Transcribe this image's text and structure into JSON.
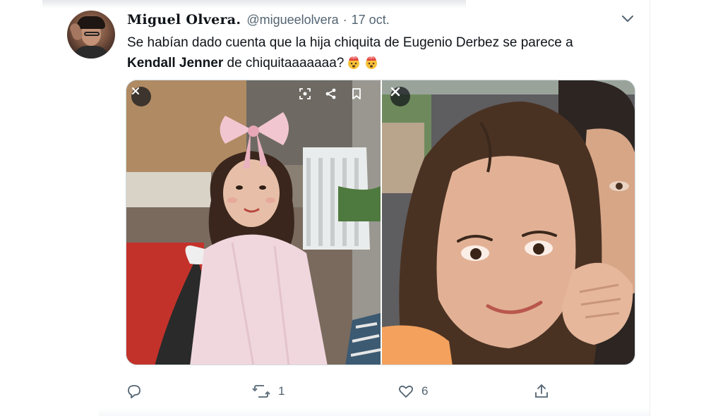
{
  "tweet": {
    "author_name": "Miguel Olvera.",
    "handle": "@migueelolvera",
    "separator": "·",
    "date": "17 oct.",
    "text_line1": "Se habían dado cuenta que la hija chiquita de Eugenio Derbez se parece a",
    "text_bold": "Kendall Jenner",
    "text_rest": " de chiquitaaaaaaa?",
    "emoji": [
      "exploding-head-emoji",
      "exploding-head-emoji"
    ]
  },
  "media": {
    "photos": [
      {
        "description_icon": "photo-left",
        "controls": [
          "close-icon",
          "screenshot-icon",
          "share-icon",
          "bookmark-icon"
        ]
      },
      {
        "description_icon": "photo-right",
        "controls": [
          "close-icon"
        ]
      }
    ]
  },
  "actions": {
    "reply": {
      "icon": "reply-icon",
      "count": ""
    },
    "retweet": {
      "icon": "retweet-icon",
      "count": "1"
    },
    "like": {
      "icon": "like-icon",
      "count": "6"
    },
    "share": {
      "icon": "share-icon",
      "count": ""
    }
  },
  "colors": {
    "text": "#0f1419",
    "secondary": "#536471",
    "border": "#cfd9de"
  }
}
